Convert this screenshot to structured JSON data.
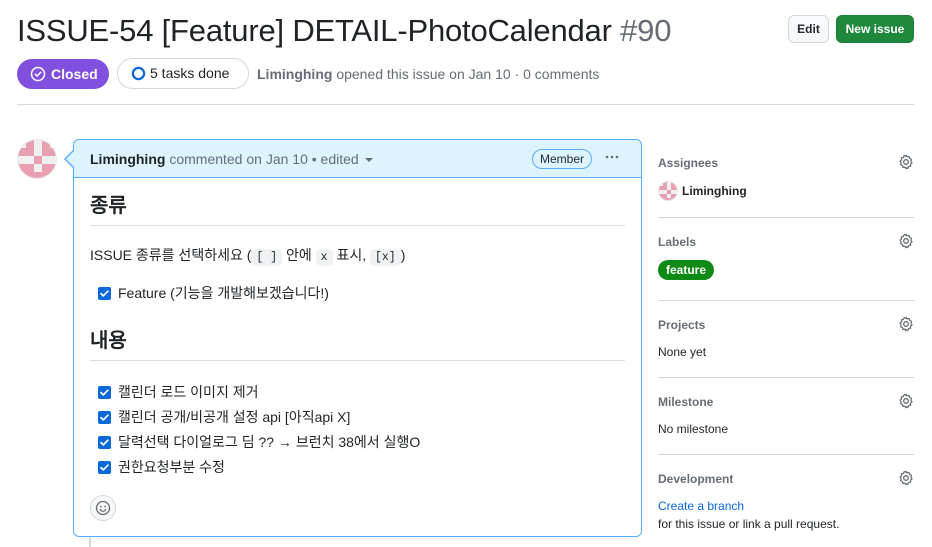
{
  "issue": {
    "title": "ISSUE-54 [Feature] DETAIL-PhotoCalendar",
    "number": "#90",
    "state": "Closed",
    "tasks_done": "5 tasks done",
    "author": "Liminghing",
    "opened_text": " opened this issue on Jan 10 · 0 comments"
  },
  "header_actions": {
    "edit_label": "Edit",
    "new_issue_label": "New issue"
  },
  "comment": {
    "author": "Liminghing",
    "meta": " commented on Jan 10 • edited",
    "role_badge": "Member",
    "more_icon": "kebab-horizontal-icon",
    "section1_heading": "종류",
    "instruction_prefix": "ISSUE 종류를 선택하세요 (",
    "instruction_code1": "[ ]",
    "instruction_mid1": " 안에 ",
    "instruction_code2": "x",
    "instruction_mid2": " 표시, ",
    "instruction_code3": "[x]",
    "instruction_suffix": ")",
    "type_tasks": [
      {
        "label": "Feature (기능을 개발해보겠습니다!)",
        "checked": true
      }
    ],
    "section2_heading": "내용",
    "content_tasks": [
      {
        "label": "캘린더 로드 이미지 제거",
        "checked": true
      },
      {
        "label": "캘린더 공개/비공개 설정 api [아직api X]",
        "checked": true
      },
      {
        "label": "달력선택 다이얼로그 딤 ?? → 브런치 38에서 실행O",
        "checked": true
      },
      {
        "label": "권한요청부분 수정",
        "checked": true
      }
    ],
    "reaction_icon": "smiley-icon"
  },
  "sidebar": {
    "assignees": {
      "title": "Assignees",
      "value": "Liminghing"
    },
    "labels": {
      "title": "Labels",
      "value": "feature",
      "color": "#0e8a16"
    },
    "projects": {
      "title": "Projects",
      "value": "None yet"
    },
    "milestone": {
      "title": "Milestone",
      "value": "No milestone"
    },
    "development": {
      "title": "Development",
      "link": "Create a branch",
      "suffix": "for this issue or link a pull request."
    }
  },
  "colors": {
    "closed_purple": "#8250df",
    "primary_green": "#1f883d",
    "comment_header_bg": "#ddf4ff",
    "comment_border": "#54aeff",
    "checkbox_blue": "#0969da"
  }
}
